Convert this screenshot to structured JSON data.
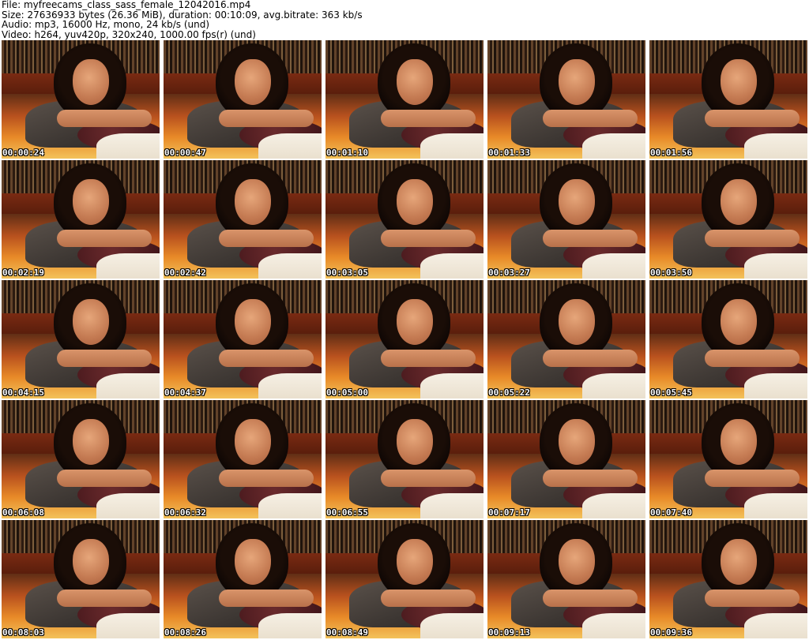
{
  "header": {
    "file": "File: myfreecams_class_sass_female_12042016.mp4",
    "size": "Size: 27636933 bytes (26.36 MiB), duration: 00:10:09, avg.bitrate: 363 kb/s",
    "audio": "Audio: mp3, 16000 Hz, mono, 24 kb/s (und)",
    "video": "Video: h264, yuv420p, 320x240, 1000.00 fps(r) (und)"
  },
  "thumbnails": [
    {
      "timestamp": "00:00:24"
    },
    {
      "timestamp": "00:00:47"
    },
    {
      "timestamp": "00:01:10"
    },
    {
      "timestamp": "00:01:33"
    },
    {
      "timestamp": "00:01:56"
    },
    {
      "timestamp": "00:02:19"
    },
    {
      "timestamp": "00:02:42"
    },
    {
      "timestamp": "00:03:05"
    },
    {
      "timestamp": "00:03:27"
    },
    {
      "timestamp": "00:03:50"
    },
    {
      "timestamp": "00:04:15"
    },
    {
      "timestamp": "00:04:37"
    },
    {
      "timestamp": "00:05:00"
    },
    {
      "timestamp": "00:05:22"
    },
    {
      "timestamp": "00:05:45"
    },
    {
      "timestamp": "00:06:08"
    },
    {
      "timestamp": "00:06:32"
    },
    {
      "timestamp": "00:06:55"
    },
    {
      "timestamp": "00:07:17"
    },
    {
      "timestamp": "00:07:40"
    },
    {
      "timestamp": "00:08:03"
    },
    {
      "timestamp": "00:08:26"
    },
    {
      "timestamp": "00:08:49"
    },
    {
      "timestamp": "00:09:13"
    },
    {
      "timestamp": "00:09:36"
    }
  ]
}
